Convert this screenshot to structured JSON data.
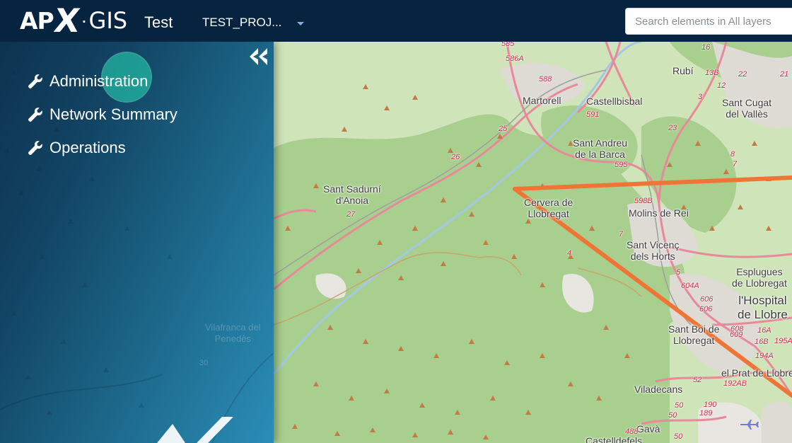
{
  "header": {
    "brand": {
      "apx": "AP",
      "x": "X",
      "dot": "·",
      "gis": "GIS"
    },
    "project_name": "Test",
    "project_select": {
      "value": "TEST_PROJ..."
    },
    "search": {
      "placeholder": "Search elements in All layers",
      "value": ""
    }
  },
  "sidebar": {
    "collapse_icon": "double-chevron-left-icon",
    "items": [
      {
        "label": "Administration",
        "icon": "wrench-icon"
      },
      {
        "label": "Network Summary",
        "icon": "wrench-icon"
      },
      {
        "label": "Operations",
        "icon": "wrench-icon"
      }
    ],
    "ghost_label": [
      "Vilafranca del",
      "Penedès"
    ],
    "ghost_num": "30"
  },
  "map": {
    "places": [
      "Rubí",
      "Sant Cugat",
      "del Vallès",
      "Martorell",
      "Castellbisbal",
      "Sant Andreu",
      "de la Barca",
      "Sant Sadurní",
      "d'Anoia",
      "Cervera de",
      "Llobregat",
      "Molins de Rei",
      "Sant Vicenç",
      "dels Horts",
      "Esplugues",
      "de Llobregat",
      "l'Hospital",
      "de Llobre",
      "Sant Boi de",
      "Llobregat",
      "el Prat de Llobre",
      "Viladecans",
      "Gavà",
      "Castelldefels"
    ],
    "road_numbers": [
      "585",
      "586A",
      "588",
      "16",
      "13B",
      "12",
      "22",
      "21",
      "3",
      "591",
      "25",
      "26",
      "27",
      "23",
      "8",
      "7",
      "595",
      "598B",
      "4",
      "7",
      "5",
      "604A",
      "606",
      "606",
      "608",
      "609",
      "16A",
      "16B",
      "195A",
      "194A",
      "192AB",
      "52",
      "50",
      "50",
      "190",
      "189",
      "488",
      "50"
    ],
    "route_color": "#f07436",
    "land_color": "#cfe4b8",
    "forest_color": "#a9cf8f",
    "urban_color": "#e0e0e0",
    "road_color": "#e8889a"
  }
}
